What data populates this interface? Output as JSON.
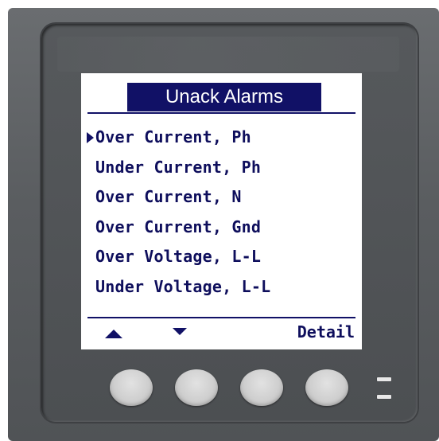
{
  "screen": {
    "title": "Unack Alarms",
    "alarms": [
      "Over Current, Ph",
      "Under Current, Ph",
      "Over Current, N",
      "Over Current, Gnd",
      "Over Voltage, L-L",
      "Under Voltage, L-L"
    ],
    "selected_index": 0,
    "softkeys": {
      "up_icon": "triangle-up-icon",
      "down_icon": "triangle-down-icon",
      "detail_label": "Detail"
    }
  },
  "colors": {
    "screen_text": "#111166",
    "title_background": "#111166",
    "title_text": "#ffffff",
    "bezel": "#5a5d60",
    "hardware_button": "#d4d4d4"
  },
  "hardware": {
    "buttons": [
      "button-1",
      "button-2",
      "button-3",
      "button-4"
    ],
    "leds": [
      "led-1",
      "led-2"
    ]
  }
}
